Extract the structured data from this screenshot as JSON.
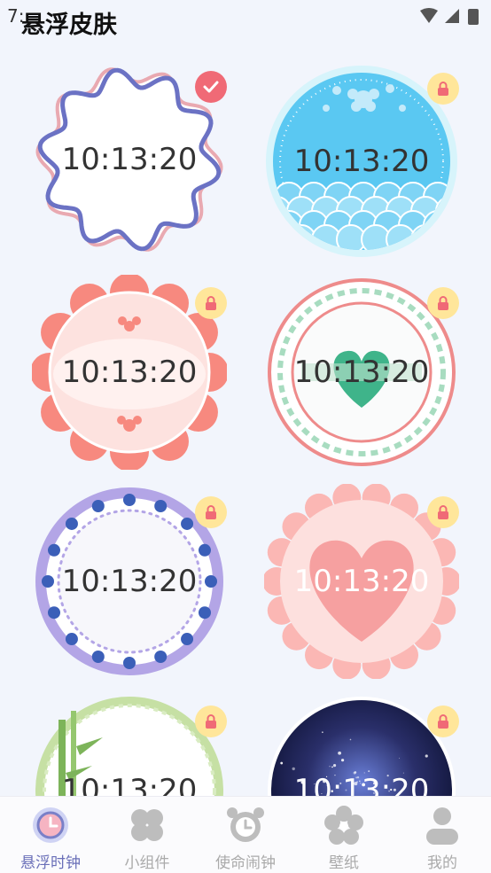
{
  "status_bar": {
    "time": "7:"
  },
  "header": {
    "title": "悬浮皮肤"
  },
  "skins": [
    {
      "time": "10:13:20",
      "selected": true,
      "locked": false
    },
    {
      "time": "10:13:20",
      "selected": false,
      "locked": true
    },
    {
      "time": "10:13:20",
      "selected": false,
      "locked": true
    },
    {
      "time": "10:13:20",
      "selected": false,
      "locked": true
    },
    {
      "time": "10:13:20",
      "selected": false,
      "locked": true
    },
    {
      "time": "10:13:20",
      "selected": false,
      "locked": true
    },
    {
      "time": "10:13:20",
      "selected": false,
      "locked": true
    },
    {
      "time": "10:13:20",
      "selected": false,
      "locked": true
    }
  ],
  "tabs": [
    {
      "label": "悬浮时钟",
      "icon": "clock-icon",
      "active": true
    },
    {
      "label": "小组件",
      "icon": "clover-icon",
      "active": false
    },
    {
      "label": "使命闹钟",
      "icon": "alarm-clock-icon",
      "active": false
    },
    {
      "label": "壁纸",
      "icon": "flower-icon",
      "active": false
    },
    {
      "label": "我的",
      "icon": "person-icon",
      "active": false
    }
  ],
  "colors": {
    "accent": "#6a6fb8",
    "lock_badge": "#ffe69a",
    "check_badge": "#f06a76",
    "background": "#f2f5fc"
  }
}
